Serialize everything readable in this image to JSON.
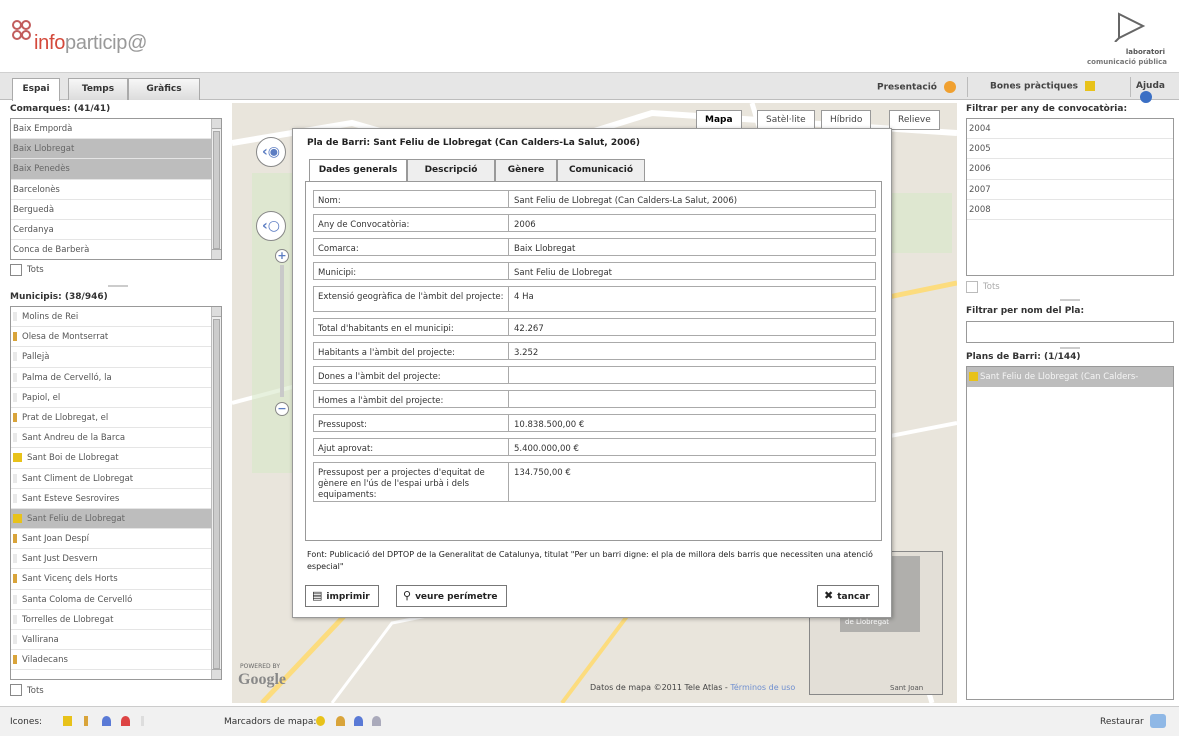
{
  "header": {
    "brand_prefix": "info",
    "brand_suffix": "particip@",
    "lab_line1": "laboratori",
    "lab_line2": "comunicació pública"
  },
  "toolbar": {
    "tabs": [
      {
        "label": "Espai",
        "active": true
      },
      {
        "label": "Temps",
        "active": false
      },
      {
        "label": "Gràfics",
        "active": false
      }
    ],
    "presentacio": "Presentació",
    "bones_practiques": "Bones pràctiques",
    "ajuda": "Ajuda"
  },
  "comarques": {
    "title": "Comarques: (41/41)",
    "items": [
      {
        "label": "Baix Empordà",
        "selected": false
      },
      {
        "label": "Baix Llobregat",
        "selected": true
      },
      {
        "label": "Baix Penedès",
        "selected": true
      },
      {
        "label": "Barcelonès",
        "selected": false
      },
      {
        "label": "Berguedà",
        "selected": false
      },
      {
        "label": "Cerdanya",
        "selected": false
      },
      {
        "label": "Conca de Barberà",
        "selected": false
      }
    ],
    "tots": "Tots"
  },
  "municipis": {
    "title": "Municipis: (38/946)",
    "items": [
      {
        "label": "Molins de Rei",
        "marker": "dim",
        "selected": false
      },
      {
        "label": "Olesa de Montserrat",
        "marker": "bar",
        "selected": false
      },
      {
        "label": "Pallejà",
        "marker": "dim",
        "selected": false
      },
      {
        "label": "Palma de Cervelló, la",
        "marker": "dim",
        "selected": false
      },
      {
        "label": "Papiol, el",
        "marker": "dim",
        "selected": false
      },
      {
        "label": "Prat de Llobregat, el",
        "marker": "bar",
        "selected": false
      },
      {
        "label": "Sant Andreu de la Barca",
        "marker": "dim",
        "selected": false
      },
      {
        "label": "Sant Boi de Llobregat",
        "marker": "pin",
        "selected": false
      },
      {
        "label": "Sant Climent de Llobregat",
        "marker": "dim",
        "selected": false
      },
      {
        "label": "Sant Esteve Sesrovires",
        "marker": "dim",
        "selected": false
      },
      {
        "label": "Sant Feliu de Llobregat",
        "marker": "pin",
        "selected": true
      },
      {
        "label": "Sant Joan Despí",
        "marker": "bar",
        "selected": false
      },
      {
        "label": "Sant Just Desvern",
        "marker": "dim",
        "selected": false
      },
      {
        "label": "Sant Vicenç dels Horts",
        "marker": "bar",
        "selected": false
      },
      {
        "label": "Santa Coloma de Cervelló",
        "marker": "dim",
        "selected": false
      },
      {
        "label": "Torrelles de Llobregat",
        "marker": "dim",
        "selected": false
      },
      {
        "label": "Vallirana",
        "marker": "dim",
        "selected": false
      },
      {
        "label": "Viladecans",
        "marker": "bar",
        "selected": false
      }
    ],
    "tots": "Tots"
  },
  "map": {
    "buttons": [
      "Mapa",
      "Satèl·lite",
      "Híbrido",
      "Relieve"
    ],
    "copyright": "Datos de mapa ©2011 Tele Atlas -",
    "terms": "Términos de uso",
    "overview_label": "de Llobregat",
    "overview_label2": "Sant Joan",
    "powered": "POWERED BY",
    "google": "Google"
  },
  "modal": {
    "title": "Pla de Barri: Sant Feliu de Llobregat (Can Calders-La Salut, 2006)",
    "tabs": [
      "Dades generals",
      "Descripció",
      "Gènere",
      "Comunicació"
    ],
    "rows": [
      {
        "key": "Nom:",
        "value": "Sant Feliu de Llobregat (Can Calders-La Salut, 2006)"
      },
      {
        "key": "Any de Convocatòria:",
        "value": "2006"
      },
      {
        "key": "Comarca:",
        "value": "Baix Llobregat"
      },
      {
        "key": "Municipi:",
        "value": "Sant Feliu de Llobregat"
      },
      {
        "key": "Extensió geogràfica de l'àmbit del projecte:",
        "value": "4 Ha"
      },
      {
        "key": "Total d'habitants en el municipi:",
        "value": "42.267"
      },
      {
        "key": "Habitants a l'àmbit del projecte:",
        "value": "3.252"
      },
      {
        "key": "Dones a l'àmbit del projecte:",
        "value": ""
      },
      {
        "key": "Homes a l'àmbit del projecte:",
        "value": ""
      },
      {
        "key": "Pressupost:",
        "value": "10.838.500,00 €"
      },
      {
        "key": "Ajut aprovat:",
        "value": "5.400.000,00 €"
      },
      {
        "key": "Pressupost per a projectes d'equitat de gènere en l'ús de l'espai urbà i dels equipaments:",
        "value": "134.750,00 €"
      }
    ],
    "note": "Font: Publicació del DPTOP de la Generalitat de Catalunya, titulat \"Per un barri digne: el pla de millora dels barris que necessiten una atenció especial\"",
    "btn_print": "imprimir",
    "btn_perimeter": "veure perímetre",
    "btn_close": "tancar"
  },
  "right": {
    "filter_year_title": "Filtrar per any de convocatòria:",
    "years": [
      "2004",
      "2005",
      "2006",
      "2007",
      "2008"
    ],
    "tots": "Tots",
    "filter_name_title": "Filtrar per nom del Pla:",
    "name_value": "",
    "plans_title": "Plans de Barri: (1/144)",
    "plans": [
      "Sant Feliu de Llobregat (Can Calders-"
    ]
  },
  "footer": {
    "icones": "Icones:",
    "marcadors": "Marcadors de mapa:",
    "restaurar": "Restaurar"
  },
  "colors": {
    "marker": "#d9a43a",
    "accent_orange": "#f0a030",
    "accent_blue": "#3b6fc4",
    "brand_red": "#d4493b"
  }
}
